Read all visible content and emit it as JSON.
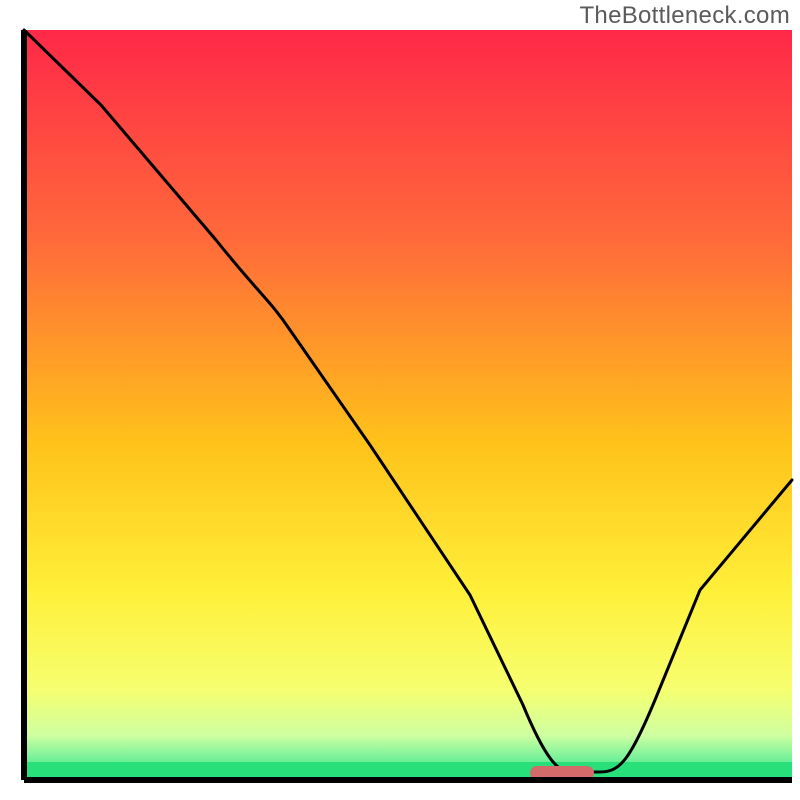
{
  "watermark": "TheBottleneck.com",
  "colors": {
    "grad_top": "#ff2848",
    "grad_mid": "#ffd21a",
    "grad_low": "#fbff60",
    "grad_green": "#27e07a",
    "curve": "#000000",
    "marker": "#d46a6a",
    "frame": "#000000"
  },
  "chart_data": {
    "type": "line",
    "title": "",
    "xlabel": "",
    "ylabel": "",
    "xlim": [
      0,
      100
    ],
    "ylim": [
      0,
      100
    ],
    "series": [
      {
        "name": "bottleneck-curve",
        "x": [
          0,
          10,
          25,
          32,
          45,
          58,
          65,
          70,
          75,
          85,
          100
        ],
        "values": [
          100,
          90,
          72,
          65,
          45,
          25,
          10,
          2,
          1,
          12,
          40
        ]
      }
    ],
    "marker": {
      "x_start": 66,
      "x_end": 74,
      "y": 1
    },
    "green_band": {
      "y_bottom": 0,
      "y_top": 2.5
    }
  }
}
